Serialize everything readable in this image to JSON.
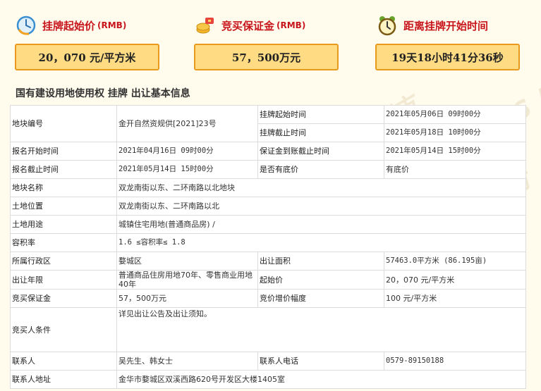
{
  "header": {
    "start_price": {
      "title": "挂牌起始价",
      "unit": "(RMB)",
      "value": "20，070 元/平方米",
      "icon": "clock-icon"
    },
    "deposit": {
      "title": "竞买保证金",
      "unit": "(RMB)",
      "value": "57，500万元",
      "icon": "money-icon"
    },
    "countdown": {
      "title": "距离挂牌开始时间",
      "value": "19天18小时41分36秒",
      "icon": "alarm-clock-icon"
    }
  },
  "section_title": "国有建设用地使用权 挂牌 出让基本信息",
  "watermark": "FCCS 房产超市",
  "colors": {
    "accent_red": "#c8161d",
    "box_fill": "#ffdc84",
    "box_border": "#e99a1d"
  },
  "table": {
    "plot_no_label": "地块编号",
    "plot_no": "金开自然资规供[2021]23号",
    "listing_start_label": "挂牌起始时间",
    "listing_start": "2021年05月06日 09时00分",
    "listing_end_label": "挂牌截止时间",
    "listing_end": "2021年05月18日 10时00分",
    "reg_start_label": "报名开始时间",
    "reg_start": "2021年04月16日 09时00分",
    "deposit_deadline_label": "保证金到账截止时间",
    "deposit_deadline": "2021年05月14日 15时00分",
    "reg_end_label": "报名截止时间",
    "reg_end": "2021年05月14日 15时00分",
    "reserve_label": "是否有底价",
    "reserve": "有底价",
    "plot_name_label": "地块名称",
    "plot_name": "双龙南街以东、二环南路以北地块",
    "location_label": "土地位置",
    "location": "双龙南街以东、二环南路以北",
    "use_label": "土地用途",
    "use": "城镇住宅用地(普通商品房) /",
    "far_label": "容积率",
    "far": "1.6 ≤容积率≤ 1.8",
    "district_label": "所属行政区",
    "district": "婺城区",
    "area_label": "出让面积",
    "area": "57463.0平方米 (86.195亩)",
    "term_label": "出让年限",
    "term": "普通商品住房用地70年、零售商业用地40年",
    "base_price_label": "起始价",
    "base_price": "20，070 元/平方米",
    "bid_deposit_label": "竞买保证金",
    "bid_deposit": "57，500万元",
    "increment_label": "竞价增价幅度",
    "increment": "100 元/平方米",
    "conditions_label": "竞买人条件",
    "conditions": "详见出让公告及出让须知。",
    "contact_label": "联系人",
    "contact": "吴先生、韩女士",
    "phone_label": "联系人电话",
    "phone": "0579-89150188",
    "address_label": "联系人地址",
    "address": "金华市婺城区双溪西路620号开发区大楼1405室"
  }
}
